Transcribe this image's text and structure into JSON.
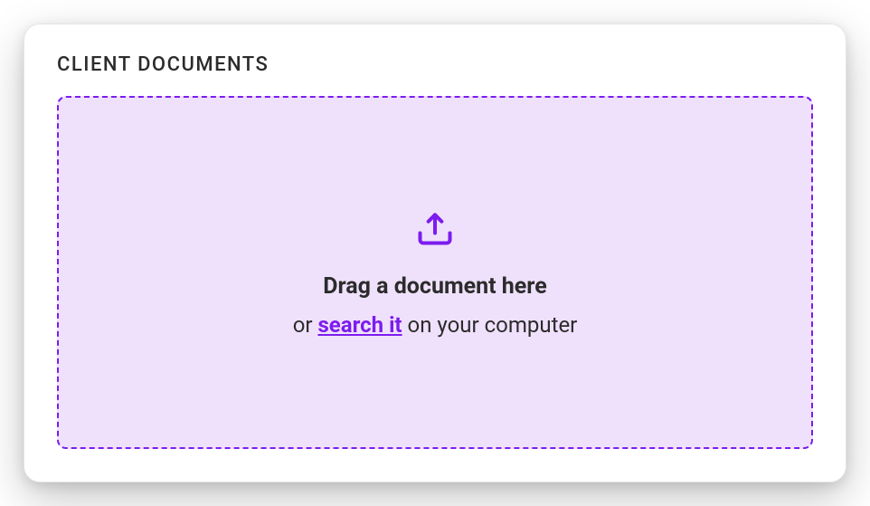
{
  "section": {
    "title": "CLIENT DOCUMENTS"
  },
  "dropzone": {
    "drag_label": "Drag a document here",
    "or_prefix": "or ",
    "search_link": "search it",
    "or_suffix": " on your computer",
    "icon_name": "upload-icon"
  },
  "colors": {
    "accent": "#7c1cef",
    "dropzone_bg": "#efe1fb",
    "text": "#2b2b2b"
  }
}
